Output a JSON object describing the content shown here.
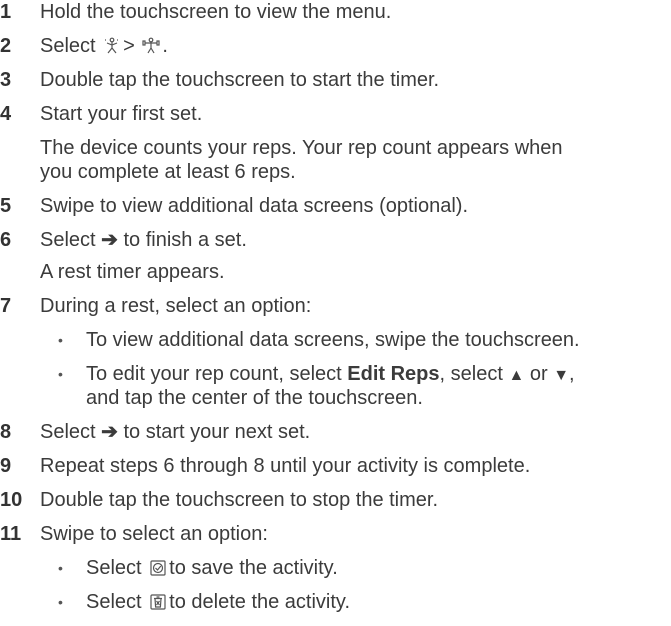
{
  "steps": [
    {
      "num": "1",
      "text": "Hold the touchscreen to view the menu."
    },
    {
      "num": "2",
      "pre": "Select",
      "sep": ">",
      "post": ".",
      "icon1": "training-run-icon",
      "icon2": "strength-icon"
    },
    {
      "num": "3",
      "text": "Double tap the touchscreen to start the timer."
    },
    {
      "num": "4",
      "text": "Start your first set.",
      "note1": "The device counts your reps. Your rep count appears when",
      "note2": "you complete at least 6 reps."
    },
    {
      "num": "5",
      "text": "Swipe to view additional data screens (optional)."
    },
    {
      "num": "6",
      "pre": "Select",
      "post": "to finish a set.",
      "icon": "arrow-right-icon",
      "note": "A rest timer appears."
    },
    {
      "num": "7",
      "text": "During a rest, select an option:",
      "bullets": [
        {
          "text": "To view additional data screens, swipe the touchscreen."
        },
        {
          "pre": "To edit your rep count, select",
          "bold": "Edit Reps",
          "mid": ", select",
          "or": "or",
          "end": ",",
          "line2": "and tap the center of the touchscreen."
        }
      ]
    },
    {
      "num": "8",
      "pre": "Select",
      "post": "to start your next set.",
      "icon": "arrow-right-icon"
    },
    {
      "num": "9",
      "text": "Repeat steps 6 through 8 until your activity is complete."
    },
    {
      "num": "10",
      "text": "Double tap the touchscreen to stop the timer."
    },
    {
      "num": "11",
      "text": "Swipe to select an option:",
      "bullets": [
        {
          "pre": "Select",
          "post": "to save the activity.",
          "icon": "save-check-icon"
        },
        {
          "pre": "Select",
          "post": "to delete the activity.",
          "icon": "trash-icon"
        }
      ]
    }
  ],
  "bullet_char": "•",
  "arrow_char": "➔",
  "up_char": "▲",
  "down_char": "▼"
}
